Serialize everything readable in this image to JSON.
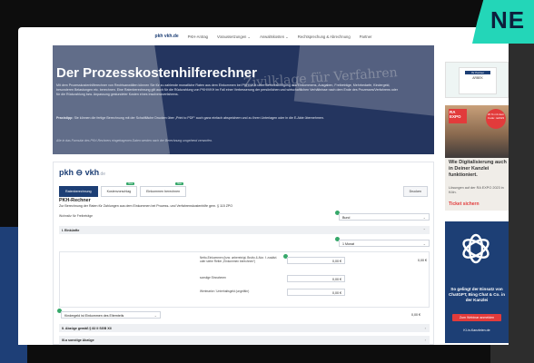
{
  "banner": {
    "label": "NE"
  },
  "topnav": {
    "logo": "pkh vkh.de",
    "items": [
      "PKH-Antrag",
      "Voraussetzungen ⌄",
      "Anwaltskosten ⌄",
      "Rechtsprechung & Abrechnung",
      "Partner"
    ]
  },
  "hero": {
    "background_text": "Zivilklage für Verfahren",
    "title": "Der Prozesskostenhilferechner",
    "description": "Mit dem Prozesskostenhilferechner von Rechtsanwälten können Sie für zu zahlende monatliche Raten aus dem Einkommen bei PKH/VKH unter Berücksichtigung des Einkommens, Ausgaben, Freibeträge, Mehrbedarfe, Kindergeld, besonderen Belastungen etc. berechnen. Eine Ratenberechnung gilt auch für die Rückzahlung von PKH/VKH im Fall einer Verbesserung der persönlichen und wirtschaftlichen Verhältnisse nach dem Ende des Prozesses/Verfahrens oder für die Rückzahlung bzw. Anpassung gestundeter Kosten eines Insolvenzverfahrens.",
    "note_bold": "Praxistipp:",
    "note": " Sie können die fertige Berechnung mit der Schaltfläche Drucken über „Print to PDF“ auch ganz einfach abspeichern und zu Ihren Unterlagen oder in die E-Akte übernehmen.",
    "footnote": "Alle in das Formular des PKH-Rechners eingetragenen Daten werden nach der Berechnung umgehend verworfen."
  },
  "calculator": {
    "brand": "pkh",
    "brand2": "vkh",
    "brand_tld": ".de",
    "tabs": [
      {
        "label": "Ratenberechnung",
        "badge": ""
      },
      {
        "label": "Kostenvorschlag",
        "badge": "Neu"
      },
      {
        "label": "Einkommen berechnen",
        "badge": "Neu"
      }
    ],
    "print_label": "Drucken",
    "title": "PKH-Rechner",
    "subtitle": "Zur Berechnung der Raten für Zahlungen aus dem Einkommen bei Prozess- und Verfahrenskostenhilfe gem. § 115 ZPO",
    "state_label": "Wohnsitz für Freibeträge",
    "state_value": "Bund",
    "section1": "I. Einkünfte",
    "period_value": "1 Monat",
    "fields": [
      {
        "label": "Netto-Einkommen (bzw. unbereinigt, Brutto & Abz. f. zusätzl. oder siehe Reiter „Einkommen berechnen“)",
        "value": "0,00 €",
        "total": "0,00 €"
      },
      {
        "label": "sonstige Einnahmen",
        "value": "0,00 €"
      },
      {
        "label": "Wertmarke / Unterhaltsgeld (ungefähr)",
        "value": "0,00 €"
      }
    ],
    "kindergeld_label": "Kindergeld ist Einkommen des Elternteils",
    "kindergeld_total": "0,00 €",
    "section2": "II. Abzüge gemäß § 82 II SGB XII",
    "section3": "III.a sonstige Abzüge"
  },
  "sidebar": {
    "ad1": {
      "caption": "Ihr Partner",
      "logo": "ARBEK"
    },
    "ad2": {
      "badge": "RA EXPO",
      "circle": "20 % mit dem Code: ra2023",
      "headline": "Wie Digitalisierung auch in Deiner Kanzlei funktioniert.",
      "sub": "Lösungen auf der RA EXPO 2023 in Köln.",
      "cta": "Ticket sichern"
    },
    "ad3": {
      "text": "So gelingt der Einsatz von ChatGPT, Bing Chat & Co. in der Kanzlei",
      "button": "Zum Webinar anmelden",
      "site": "KI-in-Kanzleien.de"
    }
  }
}
